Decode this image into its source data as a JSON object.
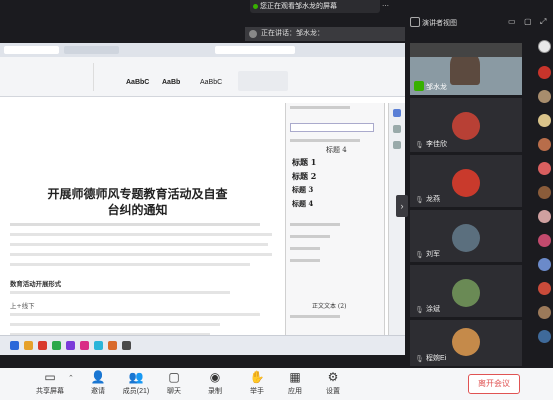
{
  "banner": {
    "text": "您正在观看邹水龙的屏幕"
  },
  "speaking": {
    "text": "正在讲话：邹水龙："
  },
  "view": {
    "label": "演讲者视图"
  },
  "document": {
    "title_line1": "开展师德师风专题教育活动及自查",
    "title_line2": "台纠的通知",
    "heading_1": "数育活动开展形式",
    "heading_2": "上+线下",
    "heading_3": "开展师德师风专题教育活动及自查台纠的通知"
  },
  "ribbon": {
    "styles": [
      "AaBbC",
      "AaBb",
      "AaBbC"
    ]
  },
  "style_pane": {
    "headings": [
      "标题 1",
      "标题 2",
      "标题 3",
      "标题 4"
    ],
    "normal_label": "正文文本 (2)",
    "top_label": "标题 4"
  },
  "participants": [
    {
      "name": "邹水龙"
    },
    {
      "name": "李佳欣"
    },
    {
      "name": "龙燕"
    },
    {
      "name": "刘军"
    },
    {
      "name": "涂斌"
    },
    {
      "name": "程婉Ei"
    }
  ],
  "toolbar": {
    "items": [
      {
        "label": "共享屏幕",
        "icon": "share-screen-icon"
      },
      {
        "label": "邀请",
        "icon": "invite-icon"
      },
      {
        "label": "成员(21)",
        "icon": "members-icon"
      },
      {
        "label": "聊天",
        "icon": "chat-icon"
      },
      {
        "label": "录制",
        "icon": "record-icon"
      },
      {
        "label": "举手",
        "icon": "raise-hand-icon"
      },
      {
        "label": "应用",
        "icon": "apps-icon"
      },
      {
        "label": "设置",
        "icon": "settings-icon"
      }
    ],
    "leave_label": "离开会议"
  },
  "colors": {
    "leave": "#e05353",
    "record": "#222222",
    "active_dot": "#38b000"
  }
}
